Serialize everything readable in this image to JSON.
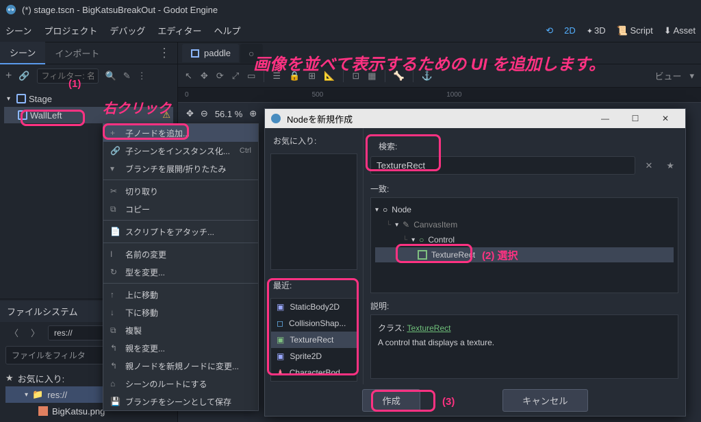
{
  "titlebar": {
    "text": "(*) stage.tscn - BigKatsuBreakOut - Godot Engine"
  },
  "menu": {
    "items": [
      "シーン",
      "プロジェクト",
      "デバッグ",
      "エディター",
      "ヘルプ"
    ],
    "modes": {
      "d2": "2D",
      "d3": "3D",
      "script": "Script",
      "asset": "Asset"
    }
  },
  "scene_panel": {
    "tabs": {
      "scene": "シーン",
      "import": "インポート"
    },
    "filter_placeholder": "フィルター: 名前",
    "tree": {
      "root": "Stage",
      "child": "WallLeft"
    }
  },
  "filesystem": {
    "title": "ファイルシステム",
    "path": "res://",
    "filter_placeholder": "ファイルをフィルタ",
    "fav_label": "お気に入り:",
    "folder": "res://",
    "file": "BigKatsu.png"
  },
  "scene_tabs": {
    "tab1": "paddle",
    "unsaved_indicator": "○"
  },
  "viewport": {
    "zoom": "56.1 %",
    "ruler_marks": [
      "0",
      "500",
      "1000"
    ],
    "view_label": "ビュー"
  },
  "context_menu": {
    "items": {
      "add_child": "子ノードを追加...",
      "instance": "子シーンをインスタンス化...",
      "instance_short": "Ctrl",
      "expand": "ブランチを展開/折りたたみ",
      "cut": "切り取り",
      "copy": "コピー",
      "attach": "スクリプトをアタッチ...",
      "rename": "名前の変更",
      "change_type": "型を変更...",
      "move_up": "上に移動",
      "move_down": "下に移動",
      "duplicate": "複製",
      "reparent": "親を変更...",
      "reparent_new": "親ノードを新規ノードに変更...",
      "make_root": "シーンのルートにする",
      "save_branch": "ブランチをシーンとして保存"
    }
  },
  "dialog": {
    "title": "Nodeを新規作成",
    "fav_label": "お気に入り:",
    "recent_label": "最近:",
    "search_label": "検索:",
    "search_value": "TextureRect",
    "match_label": "一致:",
    "desc_label": "説明:",
    "desc_class_label": "クラス:",
    "desc_class": "TextureRect",
    "desc_text": "A control that displays a texture.",
    "btn_create": "作成",
    "btn_cancel": "キャンセル",
    "recent_items": [
      "StaticBody2D",
      "CollisionShap...",
      "TextureRect",
      "Sprite2D",
      "CharacterBod..."
    ],
    "tree": {
      "node": "Node",
      "canvas": "CanvasItem",
      "control": "Control",
      "texture": "TextureRect"
    }
  },
  "annotations": {
    "headline": "画像を並べて表示するための UI を追加します。",
    "rclick": "右クリック",
    "n1": "(1)",
    "n2": "(2) 選択",
    "n3": "(3)"
  },
  "colors": {
    "accent": "#5a9aec",
    "annotation": "#ff3282"
  }
}
